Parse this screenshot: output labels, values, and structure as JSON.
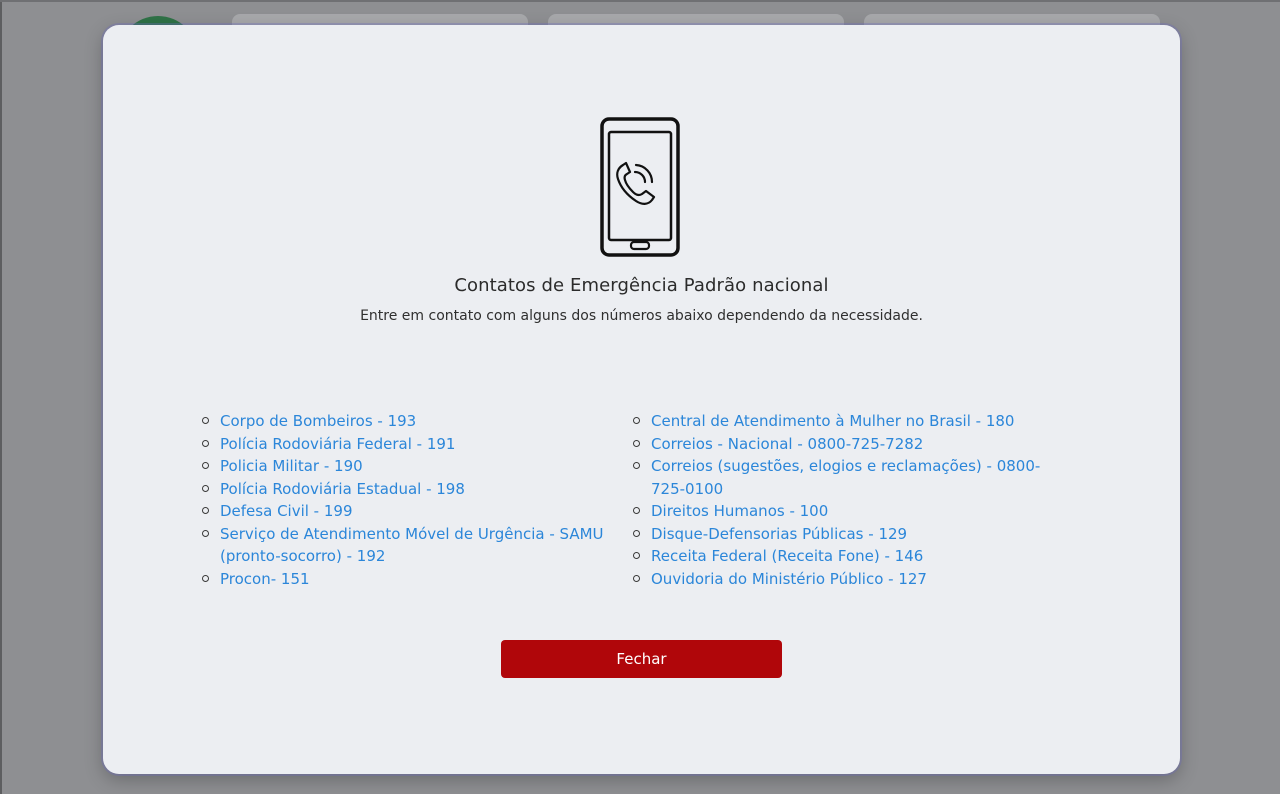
{
  "modal": {
    "title": "Contatos de Emergência Padrão nacional",
    "subtitle": "Entre em contato com alguns dos números abaixo dependendo da necessidade.",
    "icon": "phone-call-icon",
    "close_label": "Fechar"
  },
  "contacts_left": [
    "Corpo de Bombeiros - 193",
    "Polícia Rodoviária Federal - 191",
    "Policia Militar - 190",
    "Polícia Rodoviária Estadual - 198",
    "Defesa Civil - 199",
    "Serviço de Atendimento Móvel de Urgência - SAMU (pronto-socorro) - 192",
    "Procon- 151"
  ],
  "contacts_right": [
    "Central de Atendimento à Mulher no Brasil - 180",
    "Correios - Nacional - 0800-725-7282",
    "Correios (sugestões, elogios e reclamações) - 0800-725-0100",
    "Direitos Humanos - 100",
    "Disque-Defensorias Públicas - 129",
    "Receita Federal (Receita Fone) - 146",
    "Ouvidoria do Ministério Público - 127"
  ],
  "colors": {
    "overlay": "#8e8f92",
    "modal_bg": "#eceef2",
    "link": "#2b86d9",
    "close_button": "#b0060a"
  }
}
